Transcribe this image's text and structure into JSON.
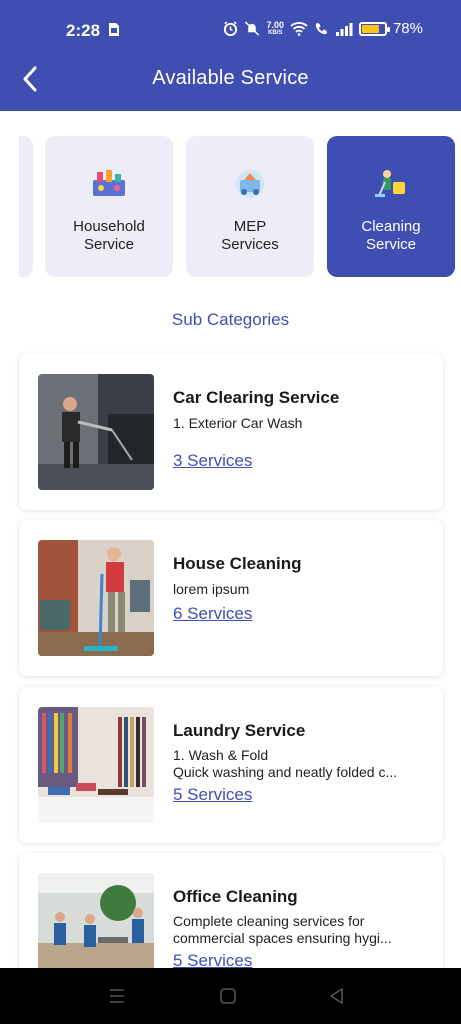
{
  "status_bar": {
    "time": "2:28",
    "speed_value": "7.00",
    "speed_unit": "KB/S",
    "battery_percent": "78%",
    "battery_level": 0.78
  },
  "app_bar": {
    "title": "Available Service",
    "back_icon": "arrow-left-icon"
  },
  "categories": [
    {
      "label": "Household\nService",
      "icon": "household-icon",
      "selected": false
    },
    {
      "label": "MEP\nServices",
      "icon": "mep-icon",
      "selected": false
    },
    {
      "label": "Cleaning\nService",
      "icon": "cleaning-icon",
      "selected": true
    }
  ],
  "sub_categories_heading": "Sub Categories",
  "services": [
    {
      "title": "Car Clearing Service",
      "description_lines": [
        "1. Exterior Car Wash"
      ],
      "link": "3 Services"
    },
    {
      "title": "House Cleaning",
      "description_lines": [
        "lorem ipsum"
      ],
      "link": "6 Services"
    },
    {
      "title": "Laundry Service",
      "description_lines": [
        "1. Wash & Fold",
        "Quick washing and neatly folded c..."
      ],
      "link": "5 Services"
    },
    {
      "title": "Office Cleaning",
      "description_lines": [
        "Complete cleaning services for",
        "commercial spaces ensuring hygi..."
      ],
      "link": "5 Services"
    }
  ],
  "colors": {
    "primary": "#3f4fb1",
    "card_bg": "#ecedf6",
    "battery": "#f5c518"
  }
}
